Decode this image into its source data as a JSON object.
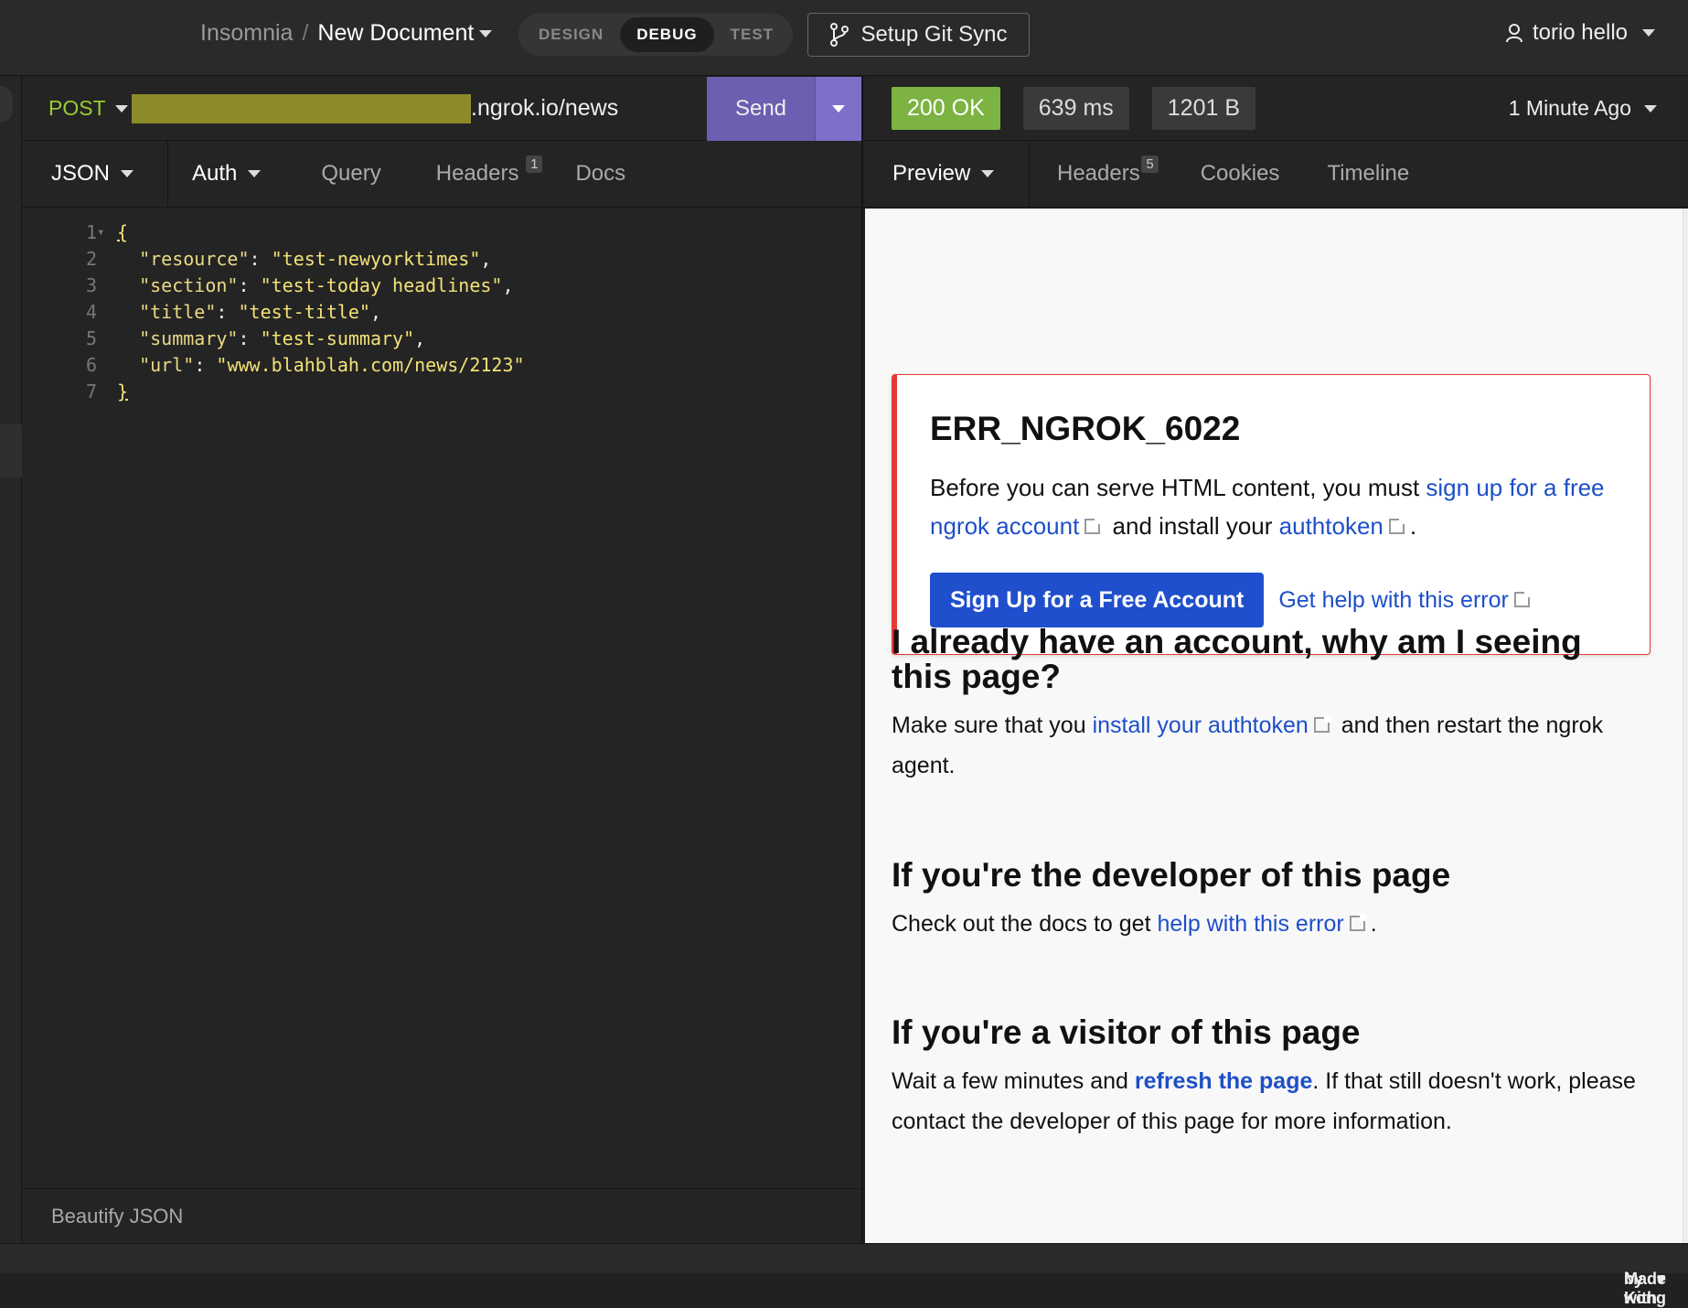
{
  "header": {
    "app_name": "Insomnia",
    "separator": "/",
    "document": "New Document",
    "modes": [
      "DESIGN",
      "DEBUG",
      "TEST"
    ],
    "active_mode": "DEBUG",
    "git_sync_label": "Setup Git Sync",
    "user_name": "torio hello"
  },
  "request": {
    "method": "POST",
    "url_visible": ".ngrok.io/news",
    "send_label": "Send",
    "tabs": {
      "body": "JSON",
      "auth": "Auth",
      "query": "Query",
      "headers": "Headers",
      "headers_count": "1",
      "docs": "Docs"
    },
    "code_lines": [
      {
        "n": "1",
        "fold": "▾",
        "text": "{"
      },
      {
        "n": "2",
        "key": "\"resource\"",
        "val": "\"test-newyorktimes\"",
        "end": ","
      },
      {
        "n": "3",
        "key": "\"section\"",
        "val": "\"test-today headlines\"",
        "end": ","
      },
      {
        "n": "4",
        "key": "\"title\"",
        "val": "\"test-title\"",
        "end": ","
      },
      {
        "n": "5",
        "key": "\"summary\"",
        "val": "\"test-summary\"",
        "end": ","
      },
      {
        "n": "6",
        "key": "\"url\"",
        "val": "\"www.blahblah.com/news/2123\"",
        "end": ""
      },
      {
        "n": "7",
        "fold": "",
        "text": "}"
      }
    ],
    "footer_action": "Beautify JSON"
  },
  "response": {
    "status": "200 OK",
    "time": "639 ms",
    "size": "1201 B",
    "ago": "1 Minute Ago",
    "tabs": {
      "preview": "Preview",
      "headers": "Headers",
      "headers_count": "5",
      "cookies": "Cookies",
      "timeline": "Timeline"
    },
    "page": {
      "error_code": "ERR_NGROK_6022",
      "error_text_1": "Before you can serve HTML content, you must ",
      "error_link_1": "sign up for a free ngrok account",
      "error_text_2": " and install your ",
      "error_link_2": "authtoken",
      "error_text_3": ".",
      "signup_button": "Sign Up for a Free Account",
      "help_link": "Get help with this error",
      "s1_title": "I already have an account, why am I seeing this page?",
      "s1_text_1": "Make sure that you ",
      "s1_link": "install your authtoken",
      "s1_text_2": " and then restart the ngrok agent.",
      "s2_title": "If you're the developer of this page",
      "s2_text_1": "Check out the docs to get ",
      "s2_link": "help with this error",
      "s2_text_2": ".",
      "s3_title": "If you're a visitor of this page",
      "s3_text_1": "Wait a few minutes and ",
      "s3_link": "refresh the page",
      "s3_text_2": ". If that still doesn't work, please contact the developer of this page for more information."
    }
  },
  "statusbar": {
    "made_with": "Made with",
    "by": "by Kong"
  }
}
